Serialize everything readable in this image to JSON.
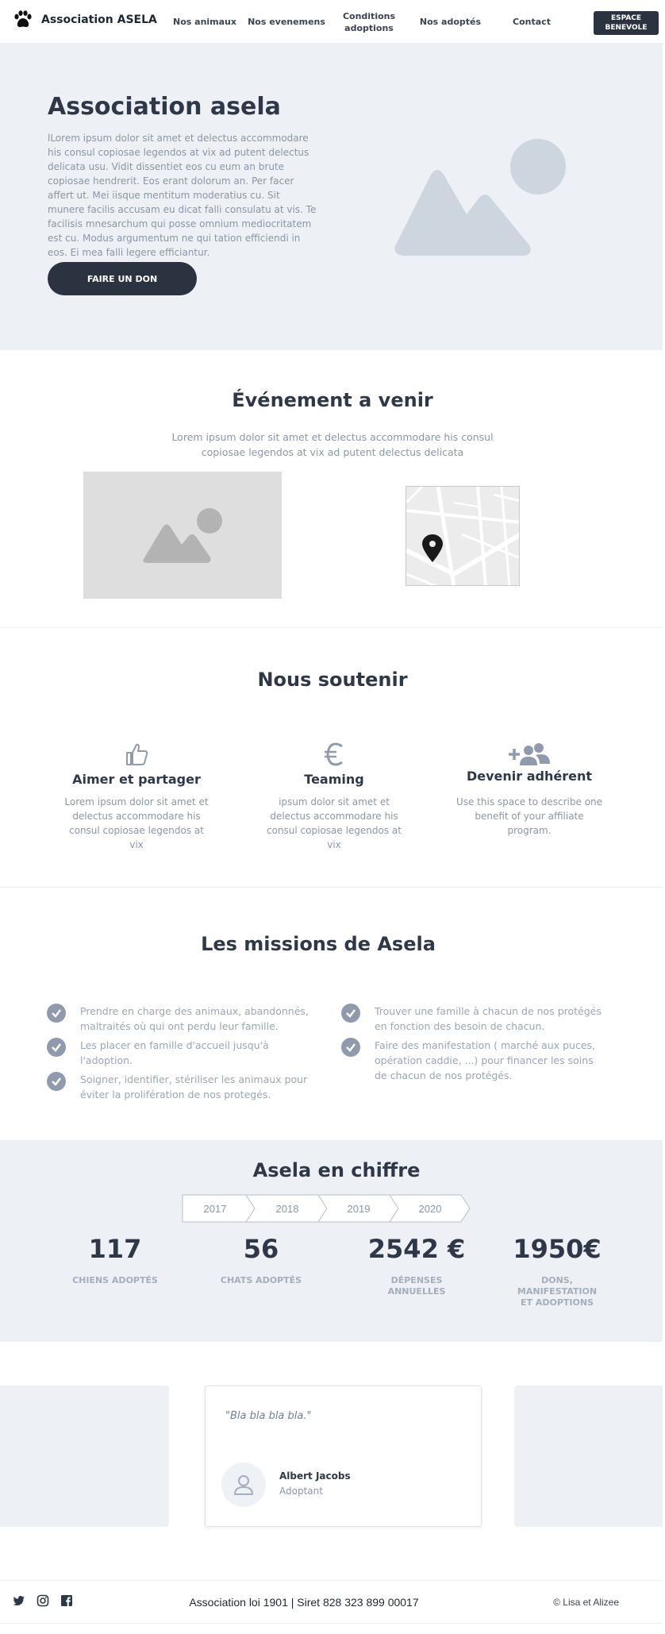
{
  "header": {
    "brand": "Association ASELA",
    "nav": [
      "Nos animaux",
      "Nos evenemens",
      "Conditions adoptions",
      "Nos adoptés",
      "Contact"
    ],
    "cta": "ESPACE BENEVOLE"
  },
  "hero": {
    "title": "Association asela",
    "text": "lLorem ipsum dolor sit amet et delectus accommodare his consul copiosae legendos at vix ad putent delectus delicata usu. Vidit dissentiet eos cu eum an brute copiosae hendrerit. Eos erant dolorum an. Per facer affert ut. Mei iisque mentitum moderatius cu. Sit munere facilis accusam eu dicat falli consulatu at vis. Te facilisis mnesarchum qui posse omnium mediocritatem est cu. Modus argumentum ne qui tation efficiendi in eos. Ei mea falli legere efficiantur.",
    "button": "FAIRE UN DON"
  },
  "event": {
    "title": "Événement a venir",
    "text": "Lorem ipsum dolor sit amet et delectus accommodare his consul copiosae legendos at vix ad putent delectus delicata"
  },
  "support": {
    "title": "Nous soutenir",
    "cards": [
      {
        "icon": "thumbs-up-icon",
        "title": "Aimer et partager",
        "text": "Lorem ipsum dolor sit amet et delectus accommodare his consul copiosae legendos at vix"
      },
      {
        "icon": "euro-icon",
        "title": "Teaming",
        "text": "ipsum dolor sit amet et delectus accommodare his consul copiosae legendos at vix"
      },
      {
        "icon": "add-users-icon",
        "title": "Devenir adhérent",
        "text": "Use this space to describe one benefit of your affiliate program."
      }
    ]
  },
  "missions": {
    "title": "Les missions de Asela",
    "left": [
      "Prendre en charge des animaux, abandonnés, maltraités où qui ont perdu leur famille.",
      "Les placer en famille d'accueil jusqu'à l'adoption.",
      "Soigner, identifier, stériliser les animaux pour éviter la prolifération de nos protegés."
    ],
    "right": [
      "Trouver une famille à chacun de nos protégés en fonction des besoin de chacun.",
      "Faire des manifestation  ( marché aux puces, opération caddie, ...) pour financer les soins de chacun de nos protégés."
    ]
  },
  "stats": {
    "title": "Asela en chiffre",
    "years": [
      "2017",
      "2018",
      "2019",
      "2020"
    ],
    "items": [
      {
        "value": "117",
        "label": "CHIENS ADOPTÉS"
      },
      {
        "value": "56",
        "label": "CHATS ADOPTÉS"
      },
      {
        "value": "2542 €",
        "label": "DÉPENSES ANNUELLES"
      },
      {
        "value": "1950€",
        "label": "DONS, MANIFESTATION ET ADOPTIONS"
      }
    ]
  },
  "testimonial": {
    "quote": "\"Bla bla bla bla.\"",
    "name": "Albert Jacobs",
    "role": "Adoptant"
  },
  "footer": {
    "center": "Association loi 1901 | Siret 828 323 899 00017",
    "right": "© Lisa et Alizee"
  },
  "colors": {
    "dark": "#2b3240",
    "hero_bg": "#edf0f4",
    "muted_text": "#8a96a9",
    "check": "#8f9bad"
  }
}
